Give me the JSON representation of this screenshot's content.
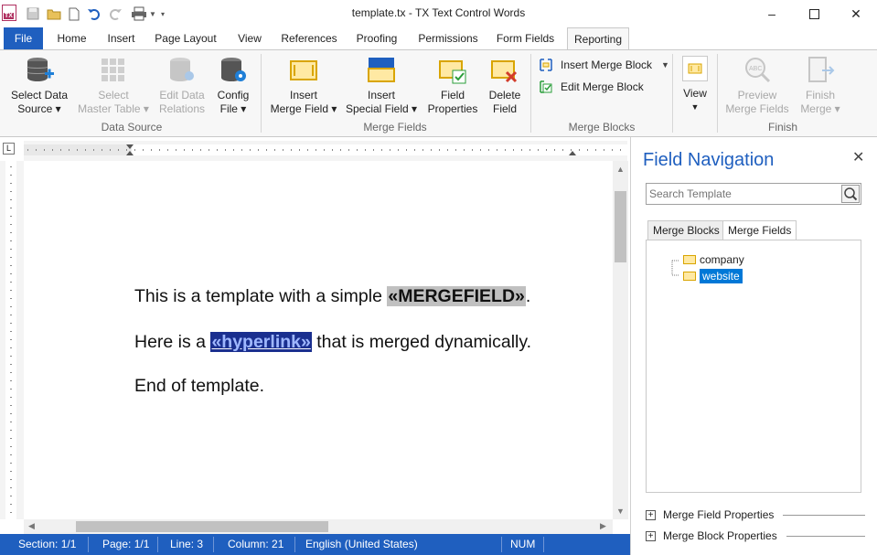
{
  "window": {
    "title": "template.tx - TX Text Control Words",
    "app_icon_text": "TX"
  },
  "ribbon_tabs": [
    "File",
    "Home",
    "Insert",
    "Page Layout",
    "View",
    "References",
    "Proofing",
    "Permissions",
    "Form Fields",
    "Reporting"
  ],
  "active_tab": "Reporting",
  "ribbon": {
    "data_source": {
      "label": "Data Source",
      "select_data_source": [
        "Select Data",
        "Source ▾"
      ],
      "select_master_table": [
        "Select",
        "Master Table ▾"
      ],
      "edit_data_relations": [
        "Edit Data",
        "Relations"
      ],
      "config_file": [
        "Config",
        "File ▾"
      ]
    },
    "merge_fields": {
      "label": "Merge Fields",
      "insert_merge_field": [
        "Insert",
        "Merge Field ▾"
      ],
      "insert_special_field": [
        "Insert",
        "Special Field ▾"
      ],
      "field_properties": [
        "Field",
        "Properties"
      ],
      "delete_field": [
        "Delete",
        "Field"
      ]
    },
    "merge_blocks": {
      "label": "Merge Blocks",
      "insert_merge_block": "Insert Merge Block",
      "edit_merge_block": "Edit Merge Block"
    },
    "view": {
      "label": "View"
    },
    "finish": {
      "label": "Finish",
      "preview_merge_fields": [
        "Preview",
        "Merge Fields"
      ],
      "finish_merge": [
        "Finish",
        "Merge ▾"
      ]
    }
  },
  "document": {
    "line1_before": "This is a template with a simple ",
    "line1_field": "«MERGEFIELD»",
    "line1_after": ".",
    "line2_before": "Here is a ",
    "line2_field": "«hyperlink»",
    "line2_after": " that is merged dynamically.",
    "line3": "End of template."
  },
  "status": {
    "section": "Section: 1/1",
    "page": "Page: 1/1",
    "line": "Line: 3",
    "column": "Column: 21",
    "language": "English (United States)",
    "num": "NUM"
  },
  "panel": {
    "title": "Field Navigation",
    "search_placeholder": "Search Template",
    "tabs": [
      "Merge Blocks",
      "Merge Fields"
    ],
    "active_tab": "Merge Fields",
    "fields": [
      "company",
      "website"
    ],
    "selected_field": "website",
    "expanders": [
      "Merge Field Properties",
      "Merge Block Properties"
    ]
  },
  "colors": {
    "accent": "#1f5fbf",
    "merge_field_bg": "#c0c0c0",
    "hyperlink_bg": "#1a2f8f",
    "selection": "#0078d7"
  }
}
